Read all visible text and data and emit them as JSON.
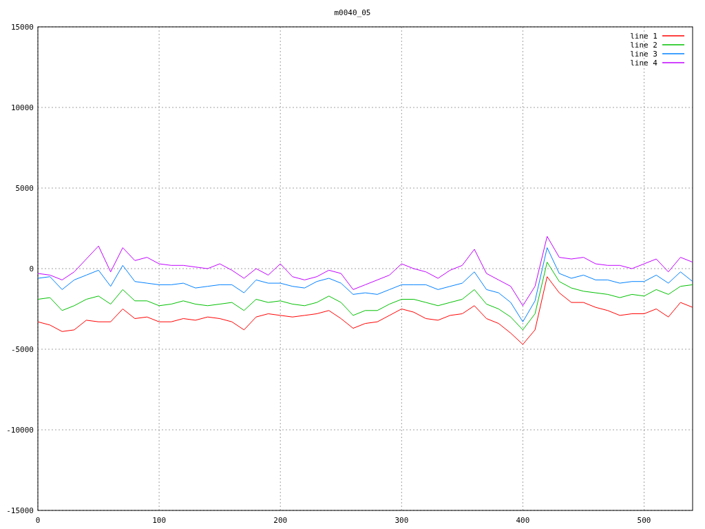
{
  "chart_data": {
    "type": "line",
    "title": "m0040_05",
    "x": [
      0,
      10,
      20,
      30,
      40,
      50,
      60,
      70,
      80,
      90,
      100,
      110,
      120,
      130,
      140,
      150,
      160,
      170,
      180,
      190,
      200,
      210,
      220,
      230,
      240,
      250,
      260,
      270,
      280,
      290,
      300,
      310,
      320,
      330,
      340,
      350,
      360,
      370,
      380,
      390,
      400,
      410,
      420,
      430,
      440,
      450,
      460,
      470,
      480,
      490,
      500,
      510,
      520,
      530,
      540
    ],
    "xlim": [
      0,
      540
    ],
    "ylim": [
      -15000,
      15000
    ],
    "grid": true,
    "legend": true,
    "xticks": [
      0,
      100,
      200,
      300,
      400,
      500
    ],
    "yticks": [
      -15000,
      -10000,
      -5000,
      0,
      5000,
      10000,
      15000
    ],
    "series": [
      {
        "name": "line 1",
        "color": "#ff0000",
        "values": [
          -3300,
          -3500,
          -3900,
          -3800,
          -3200,
          -3300,
          -3300,
          -2500,
          -3100,
          -3000,
          -3300,
          -3300,
          -3100,
          -3200,
          -3000,
          -3100,
          -3300,
          -3800,
          -3000,
          -2800,
          -2900,
          -3000,
          -2900,
          -2800,
          -2600,
          -3100,
          -3700,
          -3400,
          -3300,
          -2900,
          -2500,
          -2700,
          -3100,
          -3200,
          -2900,
          -2800,
          -2300,
          -3100,
          -3400,
          -4000,
          -4700,
          -3800,
          -500,
          -1500,
          -2100,
          -2100,
          -2400,
          -2600,
          -2900,
          -2800,
          -2800,
          -2500,
          -3000,
          -2100,
          -2400
        ]
      },
      {
        "name": "line 2",
        "color": "#00c000",
        "values": [
          -1900,
          -1800,
          -2600,
          -2300,
          -1900,
          -1700,
          -2200,
          -1300,
          -2000,
          -2000,
          -2300,
          -2200,
          -2000,
          -2200,
          -2300,
          -2200,
          -2100,
          -2600,
          -1900,
          -2100,
          -2000,
          -2200,
          -2300,
          -2100,
          -1700,
          -2100,
          -2900,
          -2600,
          -2600,
          -2200,
          -1900,
          -1900,
          -2100,
          -2300,
          -2100,
          -1900,
          -1300,
          -2200,
          -2500,
          -3000,
          -3800,
          -2800,
          400,
          -800,
          -1200,
          -1400,
          -1500,
          -1600,
          -1800,
          -1600,
          -1700,
          -1300,
          -1600,
          -1100,
          -1000
        ]
      },
      {
        "name": "line 3",
        "color": "#0080ff",
        "values": [
          -600,
          -500,
          -1300,
          -700,
          -400,
          -100,
          -1100,
          200,
          -800,
          -900,
          -1000,
          -1000,
          -900,
          -1200,
          -1100,
          -1000,
          -1000,
          -1500,
          -700,
          -900,
          -900,
          -1100,
          -1200,
          -800,
          -600,
          -900,
          -1600,
          -1500,
          -1600,
          -1300,
          -1000,
          -1000,
          -1000,
          -1300,
          -1100,
          -900,
          -200,
          -1300,
          -1500,
          -2100,
          -3300,
          -2000,
          1300,
          -300,
          -600,
          -400,
          -700,
          -700,
          -900,
          -800,
          -800,
          -400,
          -900,
          -200,
          -800
        ]
      },
      {
        "name": "line 4",
        "color": "#c000ff",
        "values": [
          -300,
          -400,
          -700,
          -200,
          600,
          1400,
          -200,
          1300,
          500,
          700,
          300,
          200,
          200,
          100,
          0,
          300,
          -100,
          -600,
          0,
          -400,
          300,
          -500,
          -700,
          -500,
          -100,
          -300,
          -1300,
          -1000,
          -700,
          -400,
          300,
          0,
          -200,
          -600,
          -100,
          200,
          1200,
          -300,
          -700,
          -1100,
          -2300,
          -1100,
          2000,
          700,
          600,
          700,
          300,
          200,
          200,
          0,
          300,
          600,
          -200,
          700,
          400
        ]
      }
    ]
  }
}
